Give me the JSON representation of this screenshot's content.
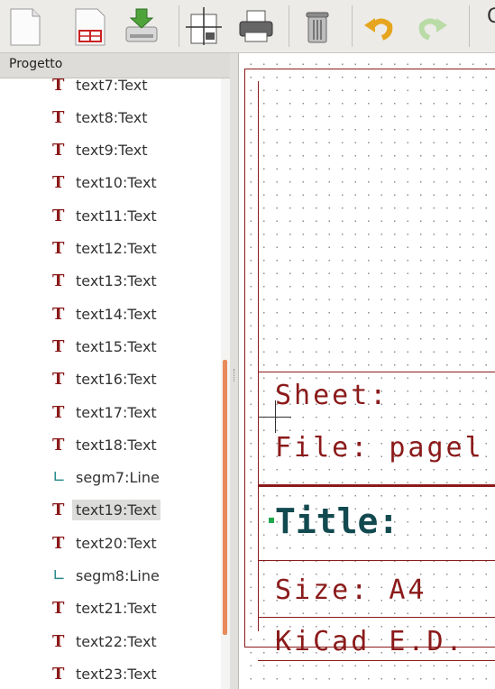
{
  "toolbar": {
    "icons": [
      "new-page-icon",
      "page-layout-icon",
      "load-icon",
      "page-settings-icon",
      "print-icon",
      "delete-icon",
      "undo-icon",
      "redo-icon"
    ],
    "overflow_label": "C"
  },
  "panel": {
    "title": "Progetto",
    "items": [
      {
        "kind": "text",
        "label": "text7:Text"
      },
      {
        "kind": "text",
        "label": "text8:Text"
      },
      {
        "kind": "text",
        "label": "text9:Text"
      },
      {
        "kind": "text",
        "label": "text10:Text"
      },
      {
        "kind": "text",
        "label": "text11:Text"
      },
      {
        "kind": "text",
        "label": "text12:Text"
      },
      {
        "kind": "text",
        "label": "text13:Text"
      },
      {
        "kind": "text",
        "label": "text14:Text"
      },
      {
        "kind": "text",
        "label": "text15:Text"
      },
      {
        "kind": "text",
        "label": "text16:Text"
      },
      {
        "kind": "text",
        "label": "text17:Text"
      },
      {
        "kind": "text",
        "label": "text18:Text"
      },
      {
        "kind": "line",
        "label": "segm7:Line"
      },
      {
        "kind": "text",
        "label": "text19:Text",
        "selected": true
      },
      {
        "kind": "text",
        "label": "text20:Text"
      },
      {
        "kind": "line",
        "label": "segm8:Line"
      },
      {
        "kind": "text",
        "label": "text21:Text"
      },
      {
        "kind": "text",
        "label": "text22:Text"
      },
      {
        "kind": "text",
        "label": "text23:Text"
      }
    ]
  },
  "canvas": {
    "sheet_label": "Sheet:",
    "file_label": "File: pagel",
    "title_label": "Title:",
    "size_label": "Size: A4",
    "kicad_label": "KiCad E.D.",
    "colors": {
      "frame": "#8b1a1a",
      "title": "#124a50",
      "anchor": "#1fa84b"
    }
  },
  "glyphs": {
    "text": "T",
    "line": "∟"
  }
}
